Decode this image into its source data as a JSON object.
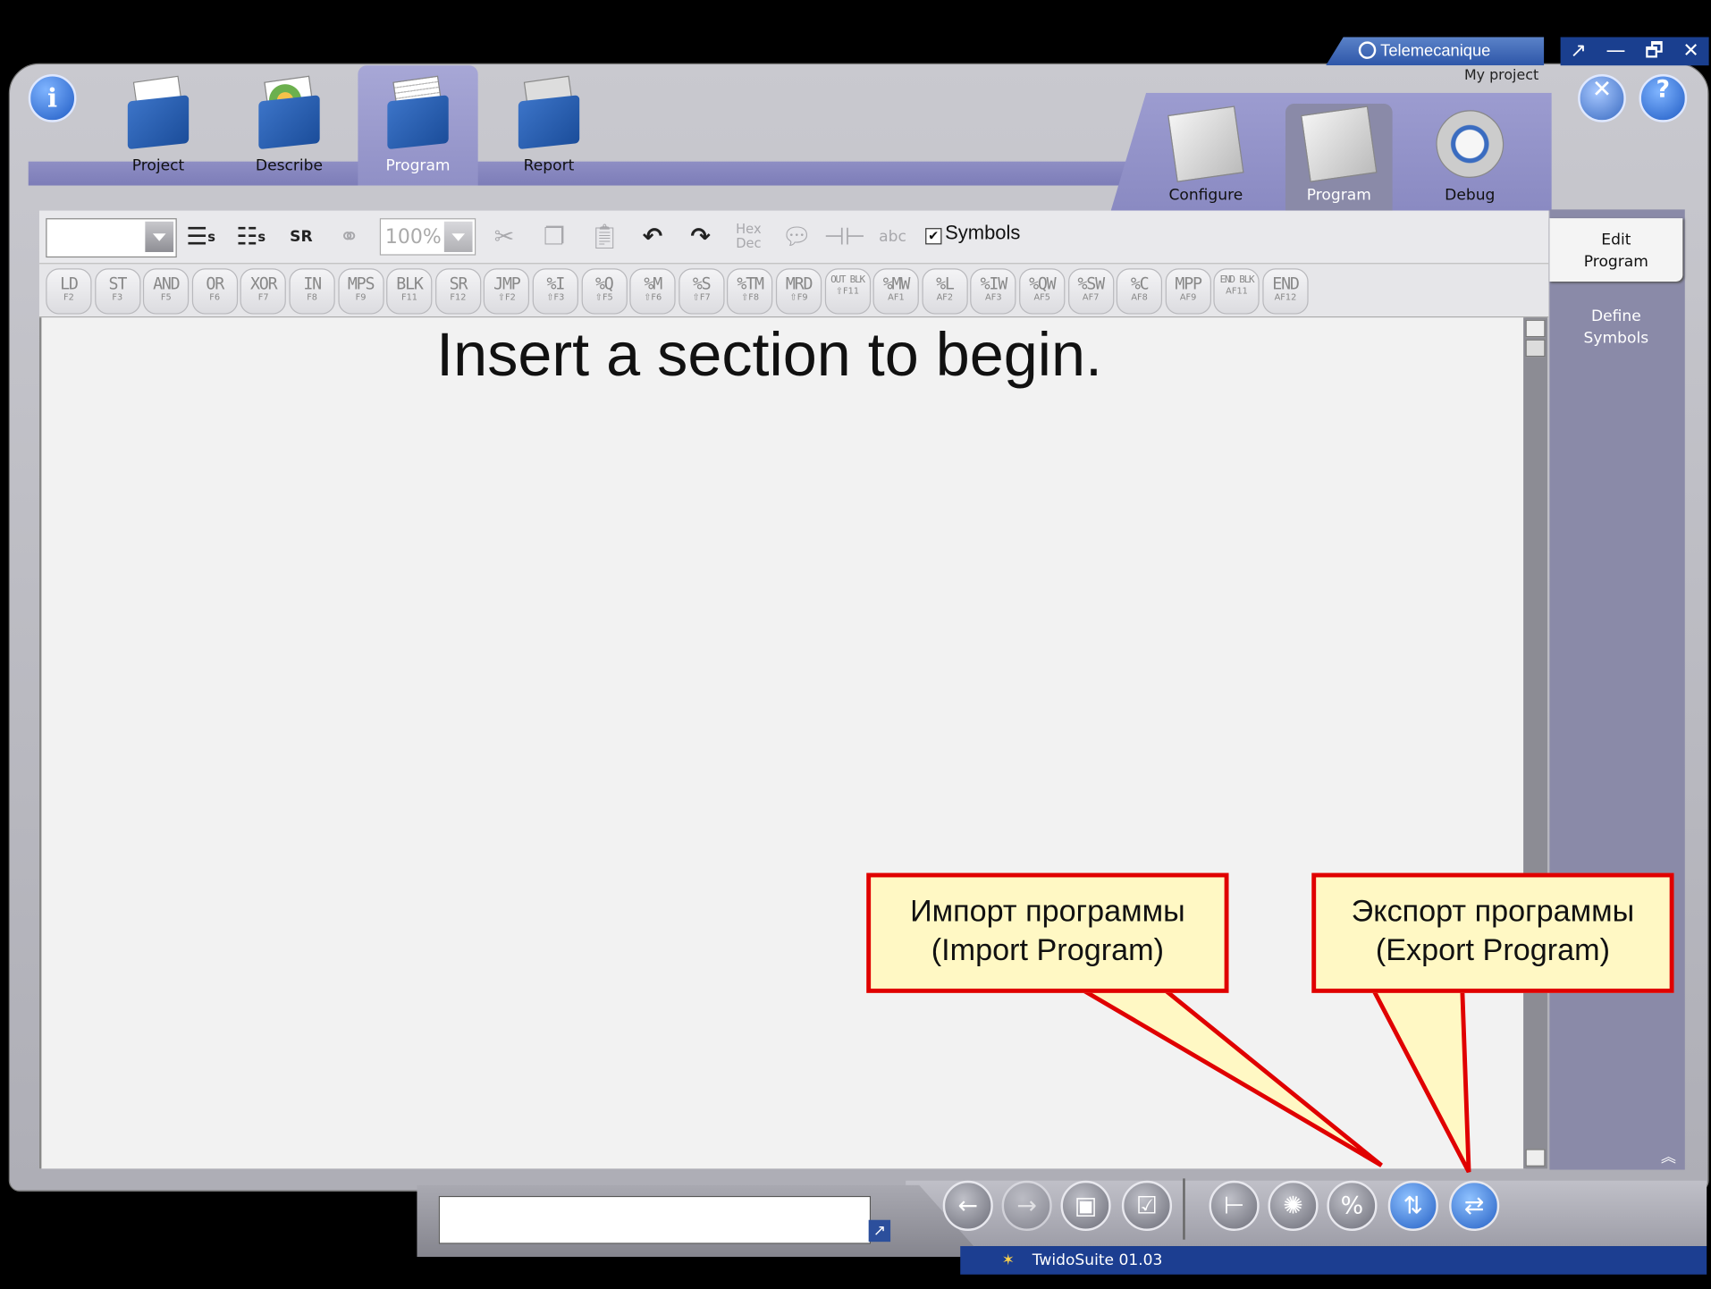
{
  "brand": "Telemecanique",
  "project_name": "My project",
  "window_controls": [
    "↗",
    "—",
    "🗗",
    "✕"
  ],
  "main_tabs": [
    {
      "label": "Project",
      "icon": "project-folder-icon"
    },
    {
      "label": "Describe",
      "icon": "describe-folder-icon"
    },
    {
      "label": "Program",
      "icon": "program-folder-icon",
      "active": true
    },
    {
      "label": "Report",
      "icon": "report-folder-icon"
    }
  ],
  "sub_tabs": [
    {
      "label": "Configure",
      "icon": "configure-icon"
    },
    {
      "label": "Program",
      "icon": "program-edit-icon",
      "active": true
    },
    {
      "label": "Debug",
      "icon": "debug-icon"
    }
  ],
  "side_panel": {
    "edit_program": "Edit\nProgram",
    "define_symbols": "Define\nSymbols"
  },
  "toolbar": {
    "zoom": "100%",
    "symbols_label": "Symbols",
    "symbols_checked": true,
    "hex": "Hex",
    "dec": "Dec"
  },
  "instructions": [
    {
      "k": "LD",
      "f": "F2"
    },
    {
      "k": "ST",
      "f": "F3"
    },
    {
      "k": "AND",
      "f": "F5"
    },
    {
      "k": "OR",
      "f": "F6"
    },
    {
      "k": "XOR",
      "f": "F7"
    },
    {
      "k": "IN",
      "f": "F8"
    },
    {
      "k": "MPS",
      "f": "F9"
    },
    {
      "k": "BLK",
      "f": "F11"
    },
    {
      "k": "SR",
      "f": "F12"
    },
    {
      "k": "JMP",
      "f": "⇧F2"
    },
    {
      "k": "%I",
      "f": "⇧F3"
    },
    {
      "k": "%Q",
      "f": "⇧F5"
    },
    {
      "k": "%M",
      "f": "⇧F6"
    },
    {
      "k": "%S",
      "f": "⇧F7"
    },
    {
      "k": "%TM",
      "f": "⇧F8"
    },
    {
      "k": "MRD",
      "f": "⇧F9"
    },
    {
      "k": "OUT BLK",
      "f": "⇧F11"
    },
    {
      "k": "%MW",
      "f": "AF1"
    },
    {
      "k": "%L",
      "f": "AF2"
    },
    {
      "k": "%IW",
      "f": "AF3"
    },
    {
      "k": "%QW",
      "f": "AF5"
    },
    {
      "k": "%SW",
      "f": "AF7"
    },
    {
      "k": "%C",
      "f": "AF8"
    },
    {
      "k": "MPP",
      "f": "AF9"
    },
    {
      "k": "END BLK",
      "f": "AF11"
    },
    {
      "k": "END",
      "f": "AF12"
    }
  ],
  "editor_message": "Insert a section to begin.",
  "status_bar": "TwidoSuite 01.03",
  "callouts": {
    "import": "Импорт программы\n(Import Program)",
    "export": "Экспорт программы\n(Export Program)"
  },
  "colors": {
    "accent_blue": "#1c3e91",
    "tab_purple": "#9090c6",
    "callout_border": "#e00000",
    "callout_fill": "#fff8c4"
  }
}
